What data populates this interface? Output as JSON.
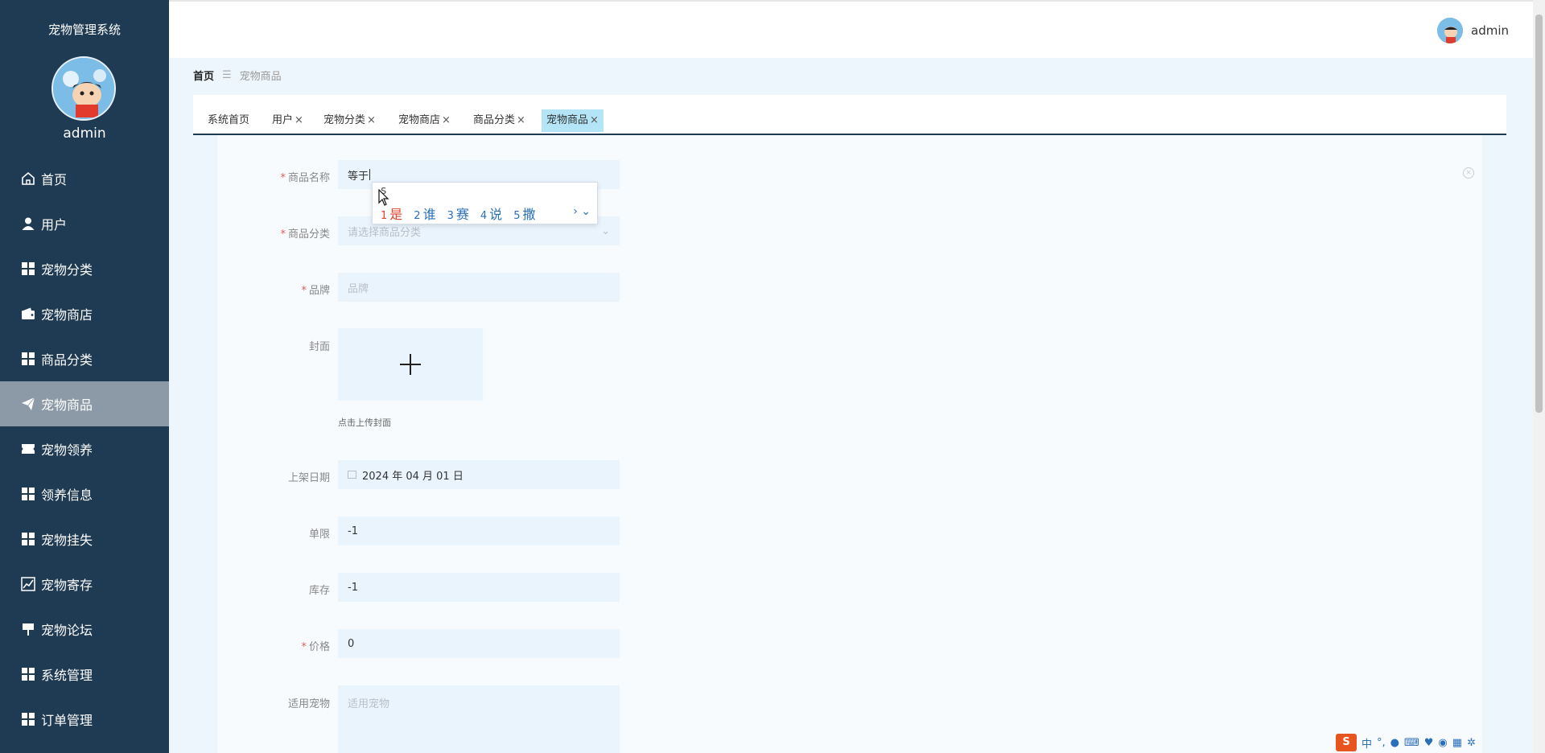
{
  "sidebar": {
    "title": "宠物管理系统",
    "username": "admin",
    "items": [
      {
        "label": "首页",
        "icon": "home-icon"
      },
      {
        "label": "用户",
        "icon": "user-icon"
      },
      {
        "label": "宠物分类",
        "icon": "grid-icon"
      },
      {
        "label": "宠物商店",
        "icon": "wallet-icon"
      },
      {
        "label": "商品分类",
        "icon": "grid-icon"
      },
      {
        "label": "宠物商品",
        "icon": "paper-plane-icon",
        "active": true
      },
      {
        "label": "宠物领养",
        "icon": "ticket-icon"
      },
      {
        "label": "领养信息",
        "icon": "grid-icon"
      },
      {
        "label": "宠物挂失",
        "icon": "grid-icon"
      },
      {
        "label": "宠物寄存",
        "icon": "chart-icon"
      },
      {
        "label": "宠物论坛",
        "icon": "flag-icon"
      },
      {
        "label": "系统管理",
        "icon": "grid-icon"
      },
      {
        "label": "订单管理",
        "icon": "grid-icon"
      }
    ]
  },
  "header": {
    "username": "admin"
  },
  "breadcrumb": {
    "home": "首页",
    "current": "宠物商品"
  },
  "tabs": [
    {
      "label": "系统首页",
      "closable": false
    },
    {
      "label": "用户",
      "closable": true
    },
    {
      "label": "宠物分类",
      "closable": true
    },
    {
      "label": "宠物商店",
      "closable": true
    },
    {
      "label": "商品分类",
      "closable": true
    },
    {
      "label": "宠物商品",
      "closable": true,
      "active": true
    }
  ],
  "form": {
    "name": {
      "label": "商品名称",
      "value": "等于",
      "required": true
    },
    "category": {
      "label": "商品分类",
      "placeholder": "请选择商品分类",
      "required": true
    },
    "brand": {
      "label": "品牌",
      "placeholder": "品牌",
      "required": true
    },
    "cover": {
      "label": "封面",
      "hint": "点击上传封面"
    },
    "date": {
      "label": "上架日期",
      "value": "2024 年 04 月 01 日"
    },
    "limit": {
      "label": "单限",
      "value": "-1"
    },
    "stock": {
      "label": "库存",
      "value": "-1"
    },
    "price": {
      "label": "价格",
      "value": "0",
      "required": true
    },
    "pet": {
      "label": "适用宠物",
      "placeholder": "适用宠物"
    }
  },
  "ime": {
    "composition": "s",
    "candidates": [
      {
        "num": "1",
        "text": "是"
      },
      {
        "num": "2",
        "text": "谁"
      },
      {
        "num": "3",
        "text": "赛"
      },
      {
        "num": "4",
        "text": "说"
      },
      {
        "num": "5",
        "text": "撒"
      }
    ]
  },
  "tray": {
    "lang": "中"
  },
  "colors": {
    "sidebar": "#1f3b53",
    "active_item": "#8c9aa8",
    "field_bg": "#eaf4fd",
    "active_tab": "#b3e5f7"
  }
}
